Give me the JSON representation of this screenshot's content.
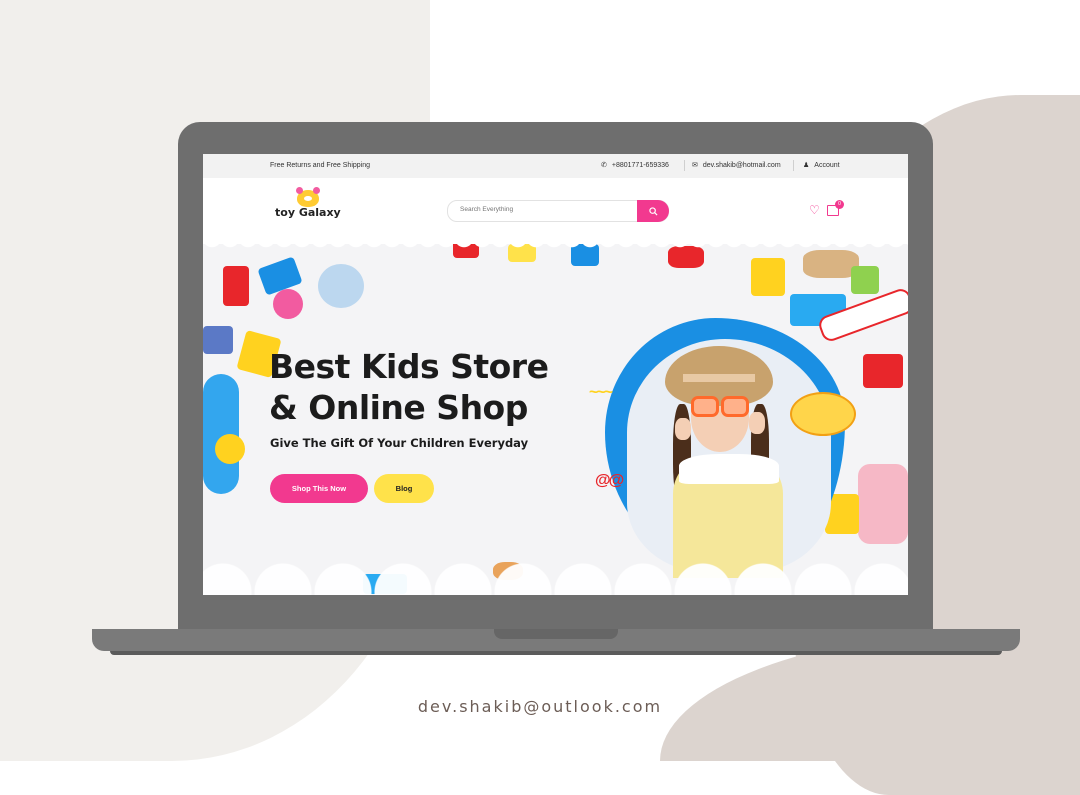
{
  "topbar": {
    "shipping": "Free Returns and Free Shipping",
    "phone": "+8801771-659336",
    "email": "dev.shakib@hotmail.com",
    "account": "Account"
  },
  "header": {
    "logo_text": "toy Galaxy",
    "search_placeholder": "Search Everything",
    "cart_count": "0"
  },
  "hero": {
    "title_line1": "Best Kids Store",
    "title_line2": "& Online Shop",
    "subtitle": "Give The Gift Of Your Children Everyday",
    "primary_button": "Shop This Now",
    "secondary_button": "Blog"
  },
  "footer": {
    "contact_email": "dev.shakib@outlook.com"
  },
  "colors": {
    "accent_pink": "#f2398f",
    "accent_yellow": "#ffe24a",
    "blob_blue": "#1a8fe3"
  }
}
